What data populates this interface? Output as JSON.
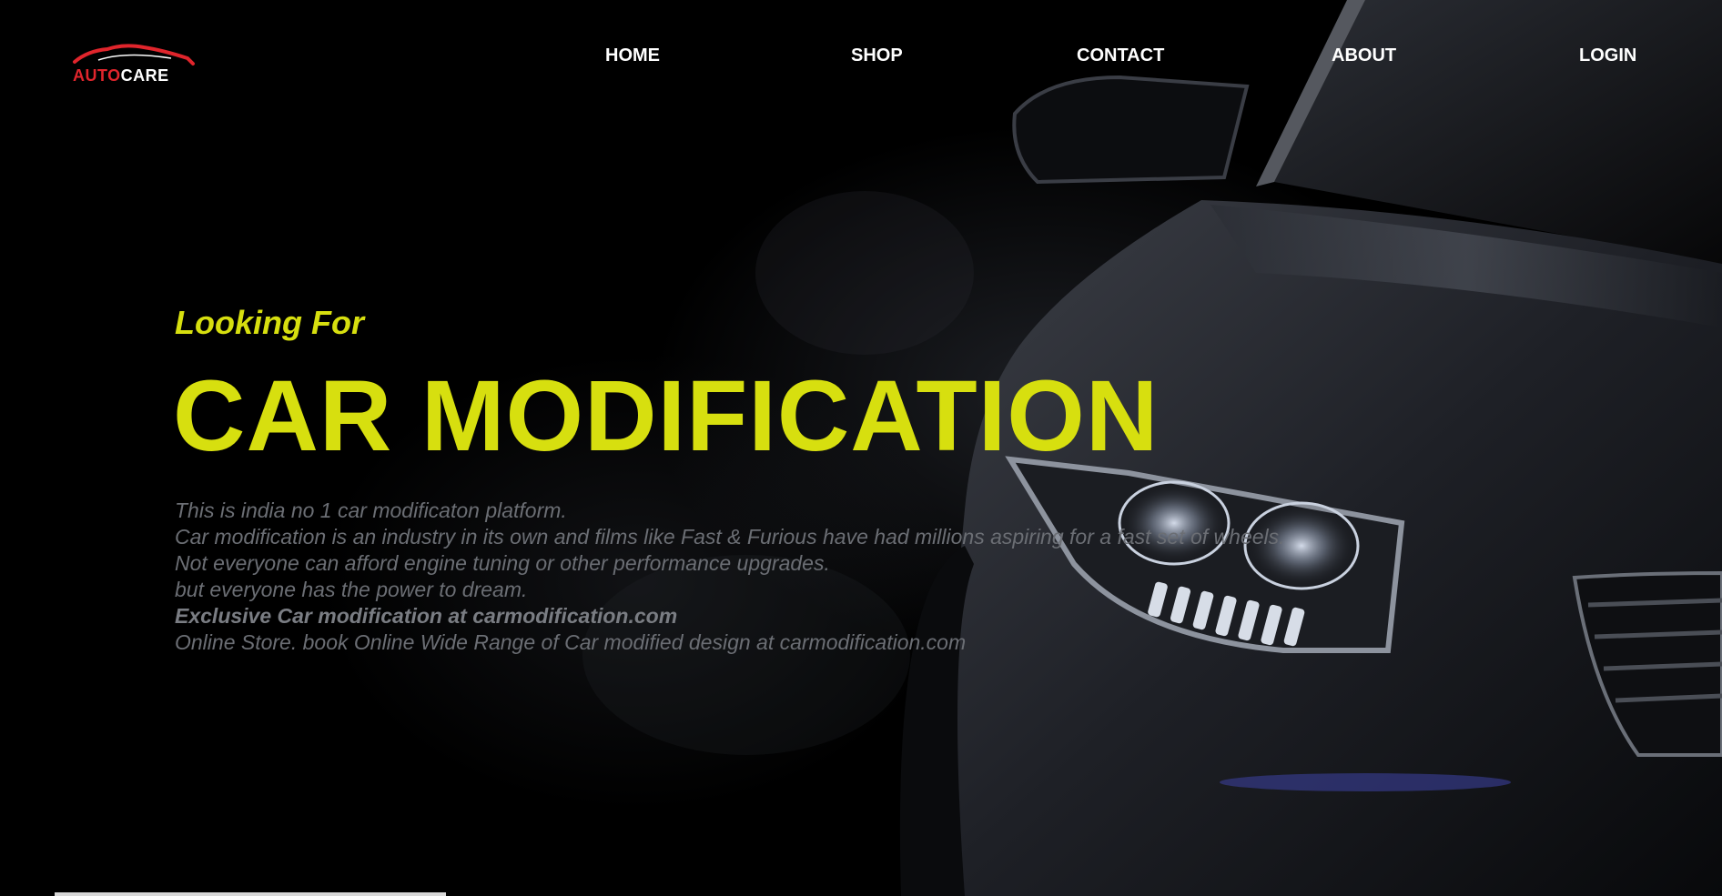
{
  "brand": {
    "word1": "AUTO",
    "word2": "CARE",
    "accent_color": "#e0252c"
  },
  "nav": {
    "items": [
      {
        "label": "HOME"
      },
      {
        "label": "SHOP"
      },
      {
        "label": "CONTACT"
      },
      {
        "label": "ABOUT"
      },
      {
        "label": "LOGIN"
      }
    ]
  },
  "hero": {
    "kicker": "Looking For",
    "headline": "CAR MODIFICATION",
    "headline_color": "#d7df0f",
    "description": [
      "This is india no 1 car modificaton platform.",
      "Car modification is an industry in its own and films like Fast & Furious have had millions aspiring for a fast set of wheels.",
      "Not everyone can afford engine tuning or other performance upgrades.",
      "but everyone has the power to dream.",
      "Exclusive Car modification at carmodification.com",
      "Online Store. book Online Wide Range of Car modified design at carmodification.com"
    ]
  }
}
